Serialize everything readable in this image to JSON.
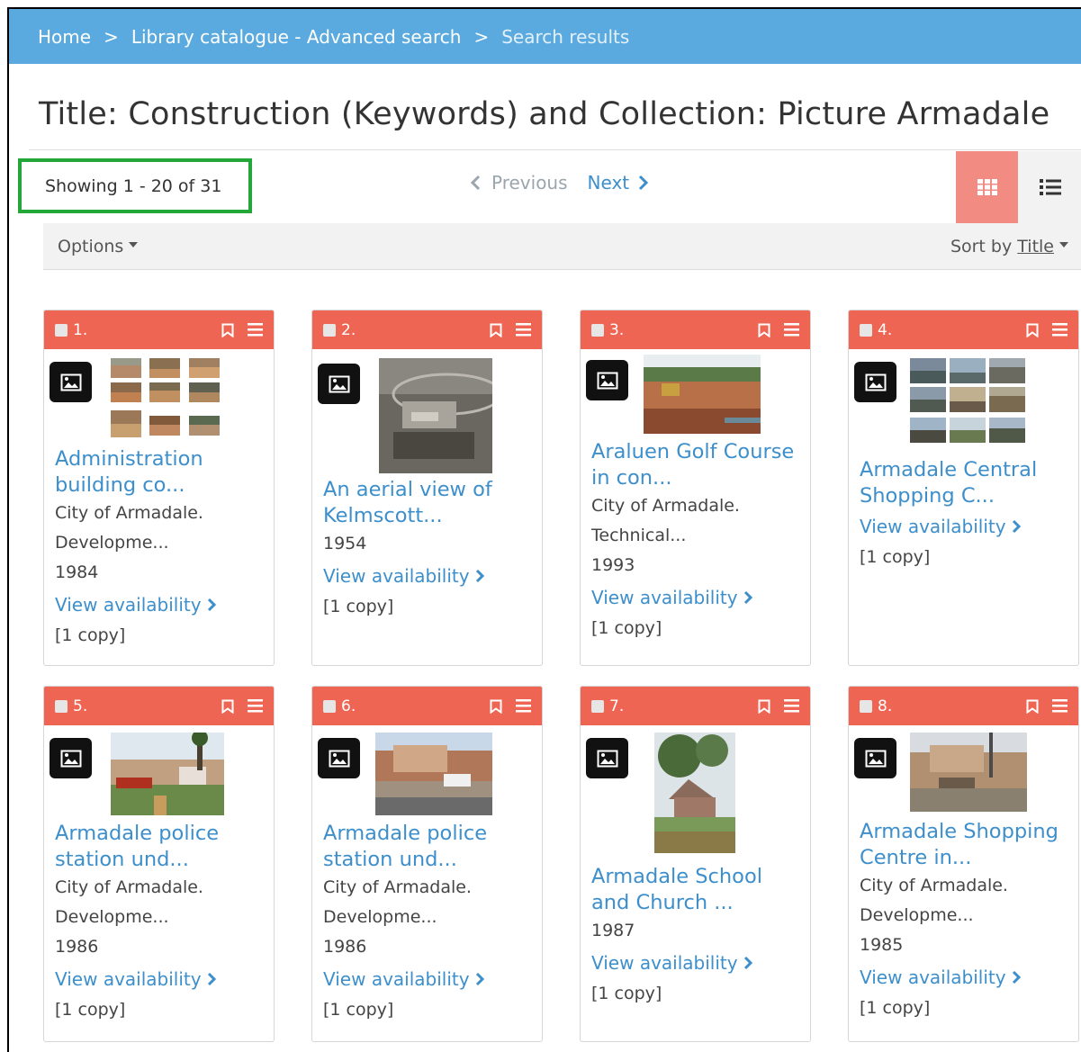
{
  "breadcrumb": {
    "home": "Home",
    "separator": ">",
    "advanced": "Library catalogue - Advanced search",
    "current": "Search results"
  },
  "page_title": "Title: Construction (Keywords) and Collection: Picture Armadale",
  "results": {
    "showing": "Showing 1 - 20 of 31",
    "previous": "Previous",
    "next": "Next"
  },
  "options": {
    "label": "Options",
    "sort_prefix": "Sort by",
    "sort_value": "Title"
  },
  "colors": {
    "header_blue": "#5aaadf",
    "card_header": "#ee6553",
    "grid_toggle_active": "#f28b82",
    "link_blue": "#3d8fcc",
    "highlight_green": "#22a738"
  },
  "icons": [
    "grid-view-icon",
    "list-view-icon",
    "bookmark-icon",
    "menu-icon",
    "image-icon",
    "chevron-right-icon",
    "chevron-left-icon"
  ],
  "cards": [
    {
      "number": "1.",
      "title1": "Administration",
      "title2": "building co...",
      "meta1": "City of Armadale.",
      "meta2": "Developme...",
      "year": "1984",
      "availability": "View availability",
      "copies": "[1 copy]"
    },
    {
      "number": "2.",
      "title1": "An aerial view of",
      "title2": "Kelmscott...",
      "meta1": "",
      "meta2": "",
      "year": "1954",
      "availability": "View availability",
      "copies": "[1 copy]"
    },
    {
      "number": "3.",
      "title1": "Araluen Golf Course",
      "title2": "in con...",
      "meta1": "City of Armadale.",
      "meta2": "Technical...",
      "year": "1993",
      "availability": "View availability",
      "copies": "[1 copy]"
    },
    {
      "number": "4.",
      "title1": "Armadale Central",
      "title2": "Shopping C...",
      "meta1": "",
      "meta2": "",
      "year": "",
      "availability": "View availability",
      "copies": "[1 copy]"
    },
    {
      "number": "5.",
      "title1": "Armadale police",
      "title2": "station und...",
      "meta1": "City of Armadale.",
      "meta2": "Developme...",
      "year": "1986",
      "availability": "View availability",
      "copies": "[1 copy]"
    },
    {
      "number": "6.",
      "title1": "Armadale police",
      "title2": "station und...",
      "meta1": "City of Armadale.",
      "meta2": "Developme...",
      "year": "1986",
      "availability": "View availability",
      "copies": "[1 copy]"
    },
    {
      "number": "7.",
      "title1": "Armadale School",
      "title2": "and Church ...",
      "meta1": "",
      "meta2": "",
      "year": "1987",
      "availability": "View availability",
      "copies": "[1 copy]"
    },
    {
      "number": "8.",
      "title1": "Armadale Shopping",
      "title2": "Centre in...",
      "meta1": "City of Armadale.",
      "meta2": "Developme...",
      "year": "1985",
      "availability": "View availability",
      "copies": "[1 copy]"
    }
  ]
}
